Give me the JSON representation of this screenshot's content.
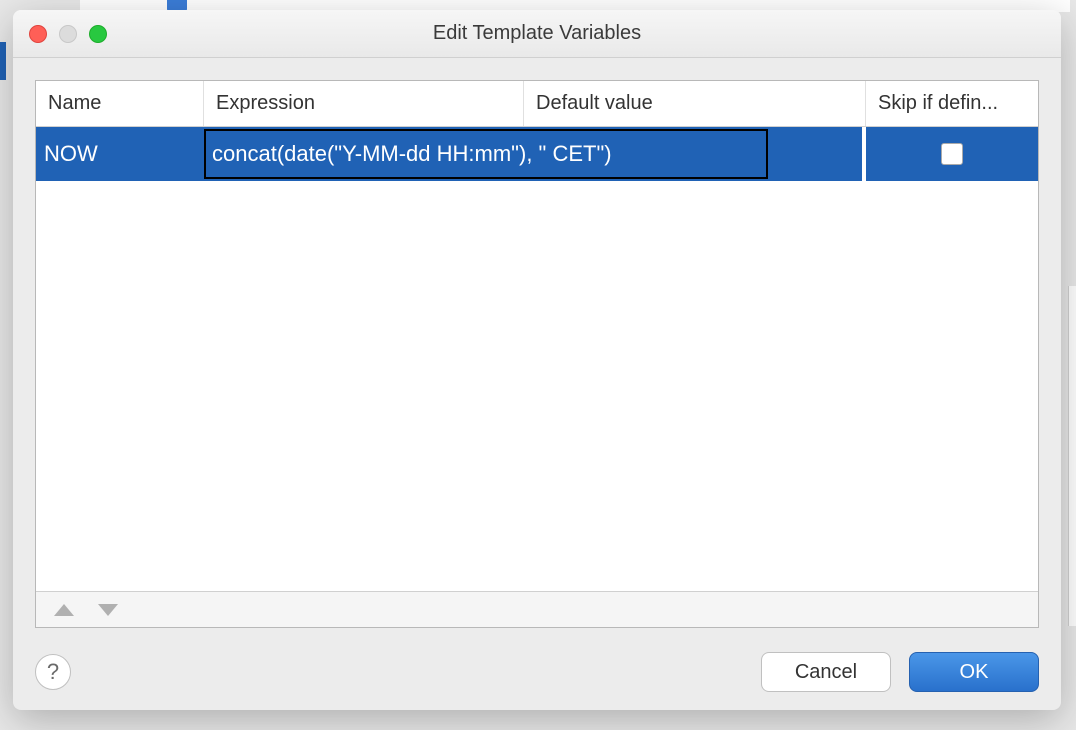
{
  "window": {
    "title": "Edit Template Variables"
  },
  "table": {
    "headers": {
      "name": "Name",
      "expression": "Expression",
      "default": "Default value",
      "skip": "Skip if defin..."
    },
    "rows": [
      {
        "name": "NOW",
        "expression": "concat(date(\"Y-MM-dd HH:mm\"), \" CET\")",
        "default": "",
        "skip": false
      }
    ]
  },
  "buttons": {
    "help": "?",
    "cancel": "Cancel",
    "ok": "OK"
  }
}
